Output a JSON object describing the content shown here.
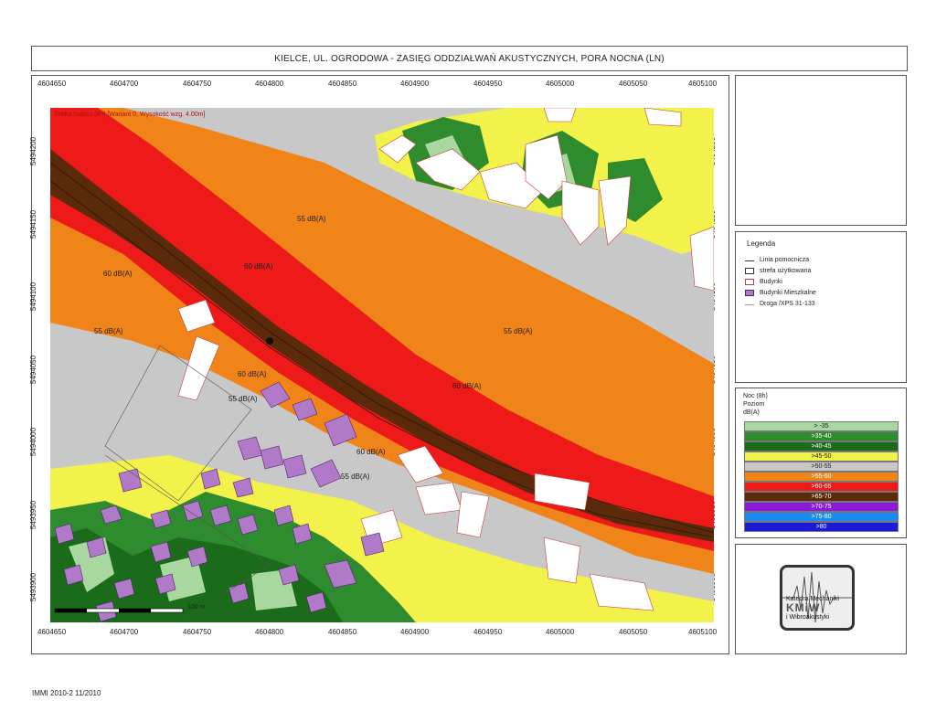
{
  "title": "KIELCE, UL. OGRODOWA - ZASIĘG ODDZIAŁWAŃ AKUSTYCZNYCH, PORA NOCNA (LN)",
  "map": {
    "header_text": "Siatka hałasu (8h)  [Wariant 0, Wysokość wzg. 4.00m]",
    "x_ticks": [
      "4604650",
      "4604700",
      "4604750",
      "4604800",
      "4604850",
      "4604900",
      "4604950",
      "4605000",
      "4605050",
      "4605100"
    ],
    "y_ticks": [
      "5494200",
      "5494150",
      "5494100",
      "5494050",
      "5494000",
      "5493950",
      "5493900"
    ],
    "contour_labels": {
      "l1": "55 dB(A)",
      "l2": "60 dB(A)",
      "l3": "60 dB(A)",
      "l4": "55 dB(A)",
      "l5": "55 dB(A)",
      "l6": "60 dB(A)",
      "l7": "55 dB(A)",
      "l8": "60 dB(A)",
      "l9": "60 dB(A)",
      "l10": "55 dB(A)"
    },
    "scale_label": "100 m"
  },
  "legend": {
    "title": "Legenda",
    "items": [
      {
        "label": "Linia pomocnicza"
      },
      {
        "label": "strefa użytkowana"
      },
      {
        "label": "Budynki"
      },
      {
        "label": "Budynki Mieszkalne"
      },
      {
        "label": "Droga /XPS 31-133"
      }
    ]
  },
  "scale_panel": {
    "title_lines": [
      "Noc (8h)",
      "Poziom",
      "dB(A)"
    ],
    "rows": [
      {
        "label": "> -35",
        "color": "#a8d8a0"
      },
      {
        "label": ">35-40",
        "color": "#2e8b2e"
      },
      {
        "label": ">40-45",
        "color": "#1a6b1a"
      },
      {
        "label": ">45-50",
        "color": "#f2f24a"
      },
      {
        "label": ">50-55",
        "color": "#c8c8c8"
      },
      {
        "label": ">55-60",
        "color": "#f08418"
      },
      {
        "label": ">60-65",
        "color": "#ee1a1a"
      },
      {
        "label": ">65-70",
        "color": "#5a2a0a"
      },
      {
        "label": ">70-75",
        "color": "#8a1ad8"
      },
      {
        "label": ">75-80",
        "color": "#1a8af0"
      },
      {
        "label": ">80",
        "color": "#1a1ad8"
      }
    ]
  },
  "logo": {
    "line1": "Katedra Mechaniki",
    "line2": "i Wibroakustyki",
    "mark": "KMiW"
  },
  "footer": "IMMI 2010-2  11/2010",
  "colors": {
    "gray": "#c8c8c8",
    "orange": "#f08418",
    "red": "#ee1a1a",
    "brown": "#5a2a0a",
    "yellow": "#f2f24a",
    "green": "#2e8b2e",
    "darkgreen": "#1a6b1a",
    "lightgreen": "#a8d8a0",
    "building": "#ffffff",
    "residential": "#b07ac8"
  }
}
